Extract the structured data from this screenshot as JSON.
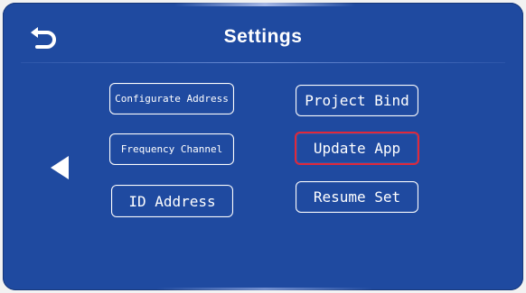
{
  "header": {
    "title": "Settings",
    "back_icon": "back-return-icon"
  },
  "nav": {
    "left_arrow_icon": "left-arrow-icon"
  },
  "buttons": {
    "configurate_address": "Configurate Address",
    "frequency_channel": "Frequency Channel",
    "id_address": "ID Address",
    "project_bind": "Project Bind",
    "update_app": "Update App",
    "resume_set": "Resume Set"
  },
  "state": {
    "selected_button": "update_app"
  },
  "colors": {
    "background": "#1f4aa0",
    "text": "#ffffff",
    "selected_border": "#e0283a"
  }
}
